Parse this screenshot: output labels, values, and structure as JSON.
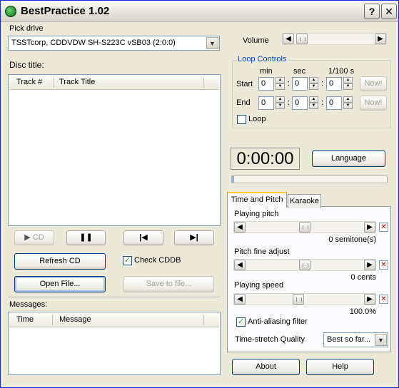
{
  "window": {
    "title": "BestPractice 1.02",
    "help_label": "?",
    "close_label": "✕"
  },
  "drive": {
    "label": "Pick drive",
    "value": "TSSTcorp, CDDVDW SH-S223C  vSB03 (2:0:0)"
  },
  "disc": {
    "label": "Disc title:",
    "columns": [
      "Track #",
      "Track Title"
    ]
  },
  "transport": {
    "cd_label": "CD",
    "pause_icon": "pause-icon",
    "prev_icon": "skip-back-icon",
    "next_icon": "skip-forward-icon"
  },
  "buttons": {
    "refresh": "Refresh CD",
    "check_cddb": "Check CDDB",
    "open_file": "Open File...",
    "save_file": "Save to file...",
    "about": "About",
    "help": "Help",
    "language": "Language"
  },
  "messages": {
    "label": "Messages:",
    "columns": [
      "Time",
      "Message"
    ]
  },
  "volume": {
    "label": "Volume"
  },
  "loop": {
    "title": "Loop Controls",
    "col_min": "min",
    "col_sec": "sec",
    "col_hs": "1/100 s",
    "start_label": "Start",
    "end_label": "End",
    "start": [
      "0",
      "0",
      "0"
    ],
    "end": [
      "0",
      "0",
      "0"
    ],
    "now_label": "Now!",
    "loop_label": "Loop",
    "loop_checked": false
  },
  "time_display": "0:00:00",
  "tabs": [
    "Time and Pitch",
    "Karaoke"
  ],
  "pitch": {
    "label": "Playing pitch",
    "value": "0 semitone(s)"
  },
  "fine": {
    "label": "Pitch fine adjust",
    "value": "0 cents"
  },
  "speed": {
    "label": "Playing speed",
    "value": "100.0%"
  },
  "antialias": {
    "label": "Anti-aliasing filter",
    "checked": true
  },
  "quality": {
    "label": "Time-stretch Quality",
    "value": "Best so far..."
  }
}
